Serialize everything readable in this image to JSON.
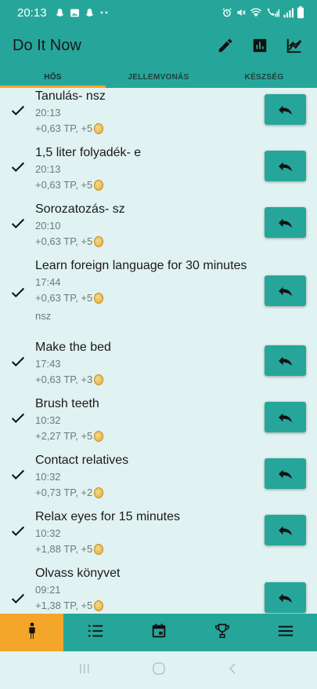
{
  "status_bar": {
    "time": "20:13",
    "left_icons": [
      "snapchat-icon",
      "image-icon",
      "snapchat-icon",
      "more-dots-icon"
    ],
    "right_icons": [
      "alarm-icon",
      "mute-icon",
      "wifi-icon",
      "call-signal-icon",
      "signal-icon",
      "battery-icon"
    ]
  },
  "app_bar": {
    "title": "Do It Now",
    "actions": [
      "edit-icon",
      "bar-chart-icon",
      "line-chart-icon"
    ]
  },
  "tabs": [
    {
      "label": "HŐS",
      "active": true
    },
    {
      "label": "JELLEMVONÁS",
      "active": false
    },
    {
      "label": "KÉSZSÉG",
      "active": false
    }
  ],
  "items": [
    {
      "title": "Tanulás- nsz",
      "time": "20:13",
      "reward": "+0,63 TP, +5",
      "note": ""
    },
    {
      "title": "1,5 liter folyadék- e",
      "time": "20:13",
      "reward": "+0,63 TP, +5",
      "note": ""
    },
    {
      "title": "Sorozatozás- sz",
      "time": "20:10",
      "reward": "+0,63 TP, +5",
      "note": ""
    },
    {
      "title": "Learn foreign language for 30 minutes",
      "time": "17:44",
      "reward": "+0,63 TP, +5",
      "note": "nsz"
    },
    {
      "title": "Make the bed",
      "time": "17:43",
      "reward": "+0,63 TP, +3",
      "note": ""
    },
    {
      "title": "Brush teeth",
      "time": "10:32",
      "reward": "+2,27 TP, +5",
      "note": ""
    },
    {
      "title": "Contact relatives",
      "time": "10:32",
      "reward": "+0,73 TP, +2",
      "note": ""
    },
    {
      "title": "Relax eyes for 15 minutes",
      "time": "10:32",
      "reward": "+1,88 TP, +5",
      "note": ""
    },
    {
      "title": "Olvass könyvet",
      "time": "09:21",
      "reward": "+1,38 TP, +5",
      "note": ""
    }
  ],
  "bottom_nav": [
    "person-icon",
    "list-icon",
    "calendar-icon",
    "trophy-icon",
    "menu-icon"
  ],
  "colors": {
    "primary": "#26a69a",
    "accent": "#f4a62a",
    "background": "#e0f2f1"
  }
}
